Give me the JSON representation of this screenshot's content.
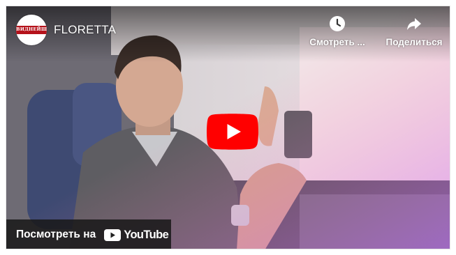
{
  "video": {
    "channel_avatar_text": "ВИДНЕЙШУМ",
    "title": "FLORETTA"
  },
  "top_actions": {
    "watch_later_label": "Смотреть ...",
    "watch_later_icon": "clock-icon",
    "share_label": "Поделиться",
    "share_icon": "share-arrow-icon"
  },
  "player": {
    "play_icon": "play-icon",
    "play_color": "#ff0000"
  },
  "watch_on": {
    "label": "Посмотреть на",
    "brand": "YouTube",
    "brand_icon": "youtube-logo-icon"
  }
}
